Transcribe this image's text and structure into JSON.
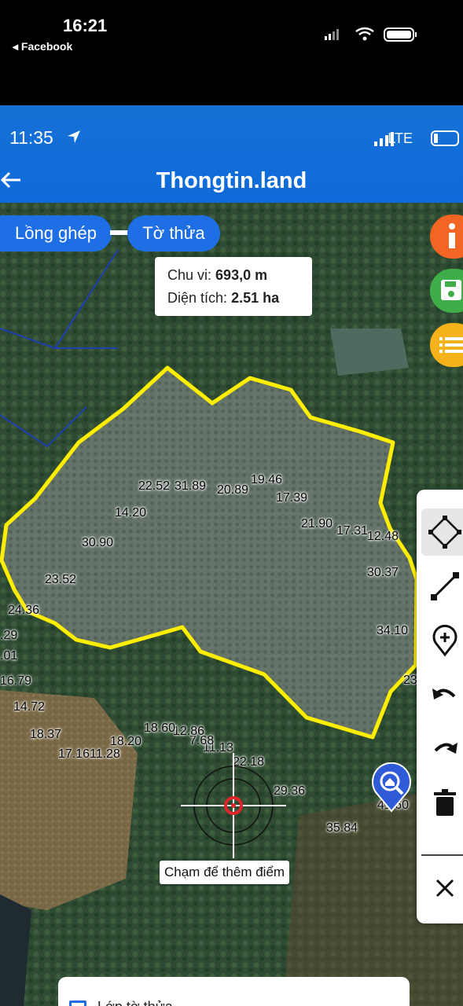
{
  "outer_status": {
    "time": "16:21",
    "back_label": "◂ Facebook"
  },
  "inner_status": {
    "time": "11:35",
    "network": "LTE"
  },
  "header": {
    "title": "Thongtin.land"
  },
  "chips": {
    "merge": "Lồng ghép",
    "parcel": "Tờ thửa"
  },
  "info": {
    "perimeter_label": "Chu vi:",
    "perimeter_value": "693,0 m",
    "area_label": "Diện tích:",
    "area_value": "2.51 ha"
  },
  "fabs": [
    {
      "name": "info-icon",
      "color": "#f26522"
    },
    {
      "name": "save-icon",
      "color": "#3fae49"
    },
    {
      "name": "list-icon",
      "color": "#f5b21b"
    }
  ],
  "tools": [
    "polygon-select-icon",
    "line-tool-icon",
    "add-point-icon",
    "undo-icon",
    "redo-icon",
    "delete-icon",
    "close-icon"
  ],
  "segment_labels": {
    "l01": "22.52",
    "l02": "31.89",
    "l03": "20.89",
    "l04": "19.46",
    "l05": "17.39",
    "l06": "21.90",
    "l07": "17.31",
    "l08": "12.48",
    "l09": "30.37",
    "l10": "34.10",
    "l11": "23",
    "l12": "41.60",
    "l13": "35.84",
    "l14": "29.36",
    "l15": "22.18",
    "l16": "11.13",
    "l17": "7.68",
    "l18": "12.86",
    "l19": "18.60",
    "l20": "18.20",
    "l21": "11.28",
    "l22": "17.16",
    "l23": "18.37",
    "l24": "14.72",
    "l25": "16.79",
    "l26": ".01",
    "l27": ".29",
    "l28": "24.36",
    "l29": "23.52",
    "l30": "30.90",
    "l31": "14.20"
  },
  "crosshair_hint": "Chạm để thêm điểm",
  "bottom_sheet": {
    "label": "Lớp tờ thửa"
  },
  "colors": {
    "header_blue": "#1671d6",
    "chip_blue": "#1e6fe6",
    "boundary_yellow": "#ffee00",
    "marker_blue": "#2f5bd8"
  }
}
